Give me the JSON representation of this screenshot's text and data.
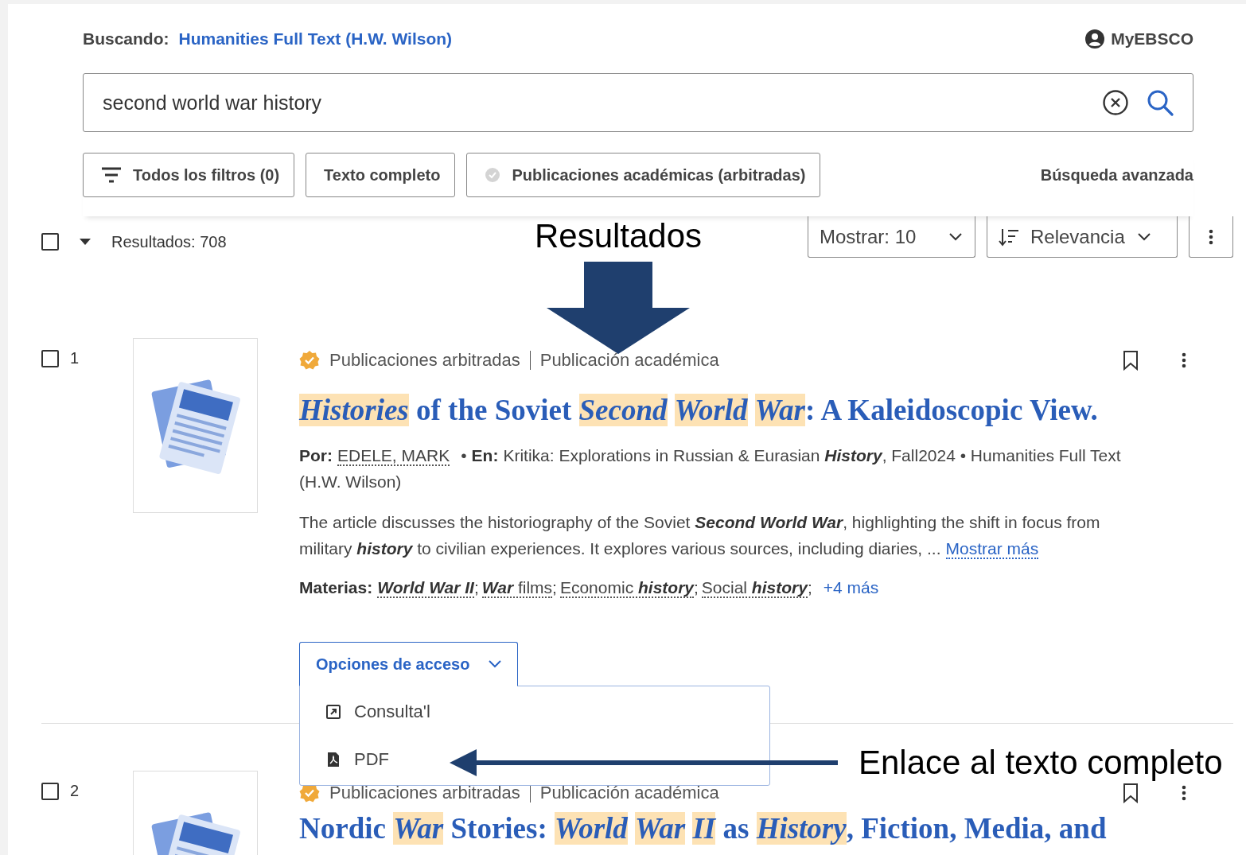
{
  "header": {
    "searching_label": "Buscando:",
    "database": "Humanities Full Text (H.W. Wilson)",
    "account": "MyEBSCO"
  },
  "search": {
    "value": "second world war history"
  },
  "filters": [
    {
      "kind": "filters",
      "label": "Todos los filtros (0)"
    },
    {
      "kind": "plain",
      "label": "Texto completo"
    },
    {
      "kind": "peer",
      "label": "Publicaciones académicas (arbitradas)"
    }
  ],
  "advanced_search": "Búsqueda avanzada",
  "results_bar": {
    "checked": false,
    "count": "Resultados: 708",
    "show": "Mostrar: 10",
    "sort": "Relevancia"
  },
  "results": [
    {
      "number": "1",
      "checked": false,
      "badge": "Publicaciones arbitradas",
      "type": "Publicación académica",
      "title": "*Histories* of the Soviet *Second* *World* *War*: A Kaleidoscopic View.",
      "by_label": "Por:",
      "author": "EDELE, MARK",
      "separator": "•",
      "in_label": "En:",
      "source": "Kritika: Explorations in Russian & Eurasian **History**, Fall2024 • Humanities Full Text (H.W. Wilson)",
      "abstract": "The article discusses the historiography of the Soviet **Second World War**, highlighting the shift in focus from military **history** to civilian experiences. It explores various sources, including diaries, ...",
      "more": "Mostrar más",
      "subjects_label": "Materias:",
      "subject_separator": ";",
      "subjects": [
        "**World War II**",
        "**War** films",
        "Economic **history**",
        "Social **history**"
      ],
      "more_subjects": "+4 más",
      "access": {
        "label": "Opciones de acceso",
        "expanded": true,
        "options": [
          {
            "kind": "link",
            "label": "Consulta'l"
          },
          {
            "kind": "pdf",
            "label": "PDF"
          }
        ]
      }
    },
    {
      "number": "2",
      "checked": false,
      "badge": "Publicaciones arbitradas",
      "type": "Publicación académica",
      "title": "Nordic *War* Stories: *World* *War* *II* as *History*, Fiction, Media, and"
    }
  ],
  "annotations": [
    {
      "kind": "down",
      "label": "Resultados"
    },
    {
      "kind": "left",
      "label": "Enlace al texto completo"
    }
  ]
}
